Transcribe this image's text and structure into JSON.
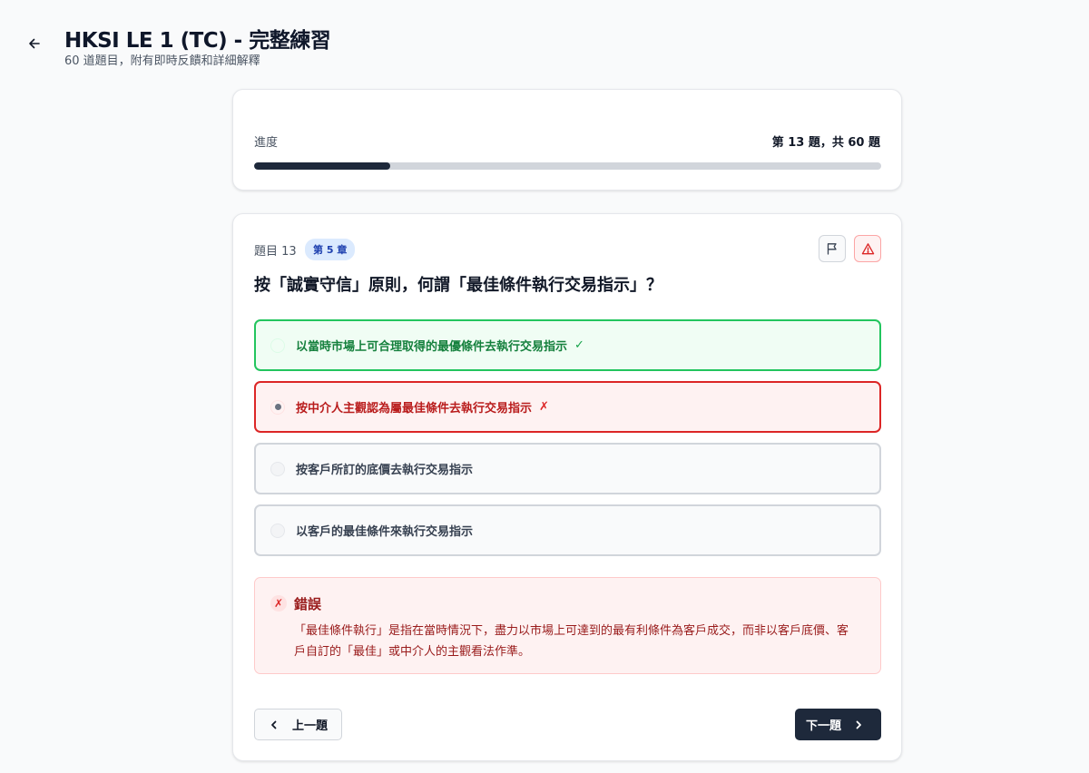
{
  "header": {
    "title": "HKSI LE 1 (TC) - 完整練習",
    "subtitle": "60 道題目，附有即時反饋和詳細解釋"
  },
  "progress": {
    "label": "進度",
    "count_text": "第 13 題，共 60 題",
    "current": 13,
    "total": 60,
    "fraction": 0.217
  },
  "question": {
    "number_label": "題目 13",
    "chapter_badge": "第 5 章",
    "text": "按「誠實守信」原則，何謂「最佳條件執行交易指示」？",
    "options": [
      {
        "text": "以當時市場上可合理取得的最優條件去執行交易指示",
        "status": "correct",
        "mark": "✓"
      },
      {
        "text": "按中介人主觀認為屬最佳條件去執行交易指示",
        "status": "wrong",
        "mark": "✗"
      },
      {
        "text": "按客戶所訂的底價去執行交易指示",
        "status": "neutral",
        "mark": ""
      },
      {
        "text": "以客戶的最佳條件來執行交易指示",
        "status": "neutral",
        "mark": ""
      }
    ]
  },
  "feedback": {
    "icon": "✗",
    "title": "錯誤",
    "text": "「最佳條件執行」是指在當時情況下，盡力以市場上可達到的最有利條件為客戶成交，而非以客戶底價、客戶自訂的「最佳」或中介人的主觀看法作準。"
  },
  "nav": {
    "prev_label": "上一題",
    "next_label": "下一題"
  },
  "icons": {
    "back": "arrow-left-icon",
    "flag": "flag-icon",
    "report": "alert-triangle-icon",
    "prev": "chevron-left-icon",
    "next": "chevron-right-icon"
  },
  "colors": {
    "primary_dark": "#1e293b",
    "correct": "#22c55e",
    "wrong": "#dc2626",
    "badge_bg": "#dbeafe",
    "badge_text": "#1e40af"
  }
}
